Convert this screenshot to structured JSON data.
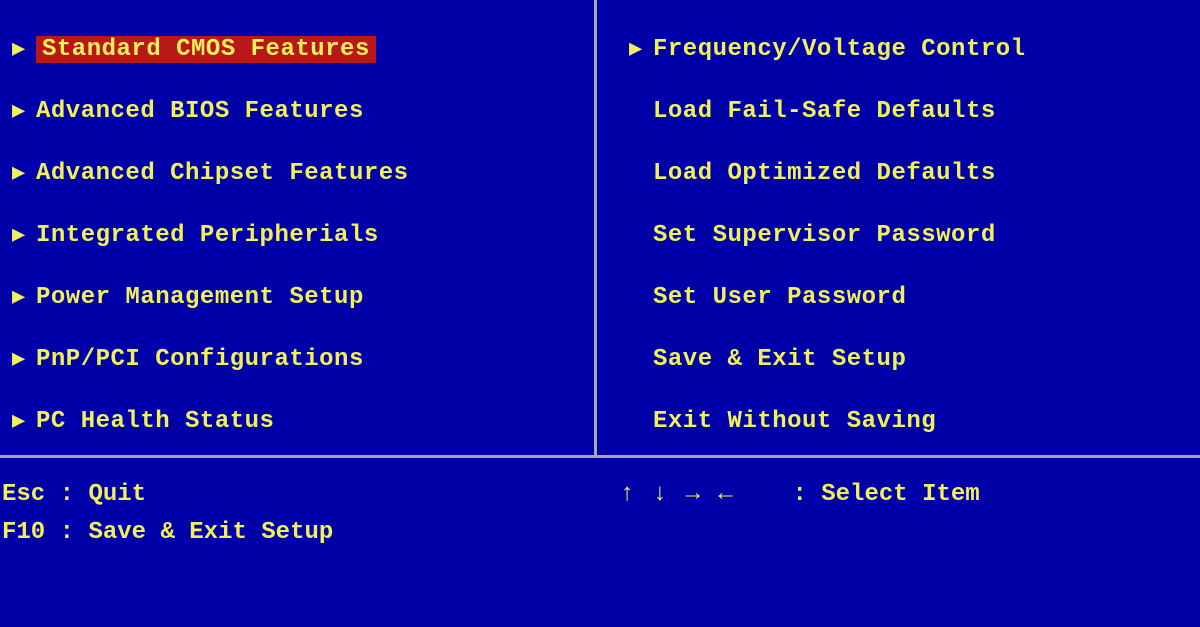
{
  "menu": {
    "left": [
      {
        "label": "Standard CMOS Features",
        "arrow": true,
        "selected": true
      },
      {
        "label": "Advanced BIOS Features",
        "arrow": true,
        "selected": false
      },
      {
        "label": "Advanced Chipset Features",
        "arrow": true,
        "selected": false
      },
      {
        "label": "Integrated Peripherials",
        "arrow": true,
        "selected": false
      },
      {
        "label": "Power Management Setup",
        "arrow": true,
        "selected": false
      },
      {
        "label": "PnP/PCI Configurations",
        "arrow": true,
        "selected": false
      },
      {
        "label": "PC Health Status",
        "arrow": true,
        "selected": false
      }
    ],
    "right": [
      {
        "label": "Frequency/Voltage Control",
        "arrow": true,
        "selected": false
      },
      {
        "label": "Load Fail-Safe Defaults",
        "arrow": false,
        "selected": false
      },
      {
        "label": "Load Optimized Defaults",
        "arrow": false,
        "selected": false
      },
      {
        "label": "Set Supervisor Password",
        "arrow": false,
        "selected": false
      },
      {
        "label": "Set User Password",
        "arrow": false,
        "selected": false
      },
      {
        "label": "Save & Exit Setup",
        "arrow": false,
        "selected": false
      },
      {
        "label": "Exit Without Saving",
        "arrow": false,
        "selected": false
      }
    ]
  },
  "footer": {
    "esc_key": "Esc",
    "esc_action": "Quit",
    "f10_key": "F10",
    "f10_action": "Save & Exit Setup",
    "arrows": "↑ ↓ → ←",
    "arrows_action": "Select Item"
  },
  "glyphs": {
    "triangle": "▶"
  }
}
